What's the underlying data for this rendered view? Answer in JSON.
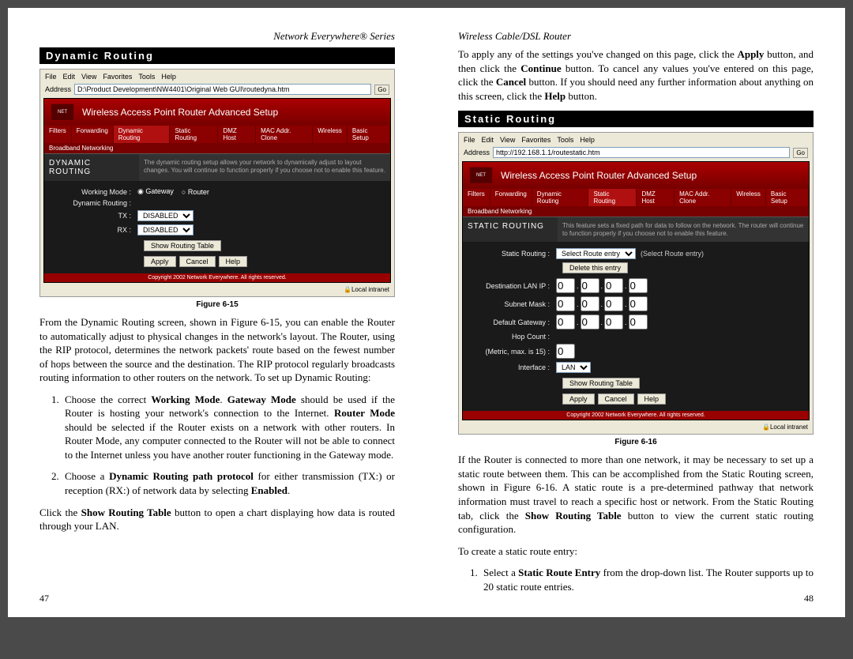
{
  "left": {
    "header": "Network Everywhere® Series",
    "section": "Dynamic Routing",
    "fig": {
      "menu": [
        "File",
        "Edit",
        "View",
        "Favorites",
        "Tools",
        "Help"
      ],
      "addr_label": "Address",
      "addr_value": "D:\\Product Development\\NW4401\\Original Web GUI\\routedyna.htm",
      "go": "Go",
      "router_title": "Wireless Access Point Router Advanced Setup",
      "tabs": [
        "Filters",
        "Forwarding",
        "Dynamic Routing",
        "Static Routing",
        "DMZ Host",
        "MAC Addr. Clone",
        "Wireless"
      ],
      "tab_right": "Basic Setup",
      "band": "Broadband Networking",
      "panel_name": "DYNAMIC ROUTING",
      "panel_desc": "The dynamic routing setup allows your network to dynamically adjust to layout changes. You will continue to function properly if you choose not to enable this feature.",
      "rows": {
        "mode_label": "Working Mode :",
        "mode_gateway": "Gateway",
        "mode_router": "Router",
        "dr_label": "Dynamic Routing :",
        "tx_label": "TX :",
        "rx_label": "RX :",
        "disabled": "DISABLED"
      },
      "btns": {
        "srt": "Show Routing Table",
        "apply": "Apply",
        "cancel": "Cancel",
        "help": "Help"
      },
      "copy": "Copyright 2002 Network Everywhere. All rights reserved.",
      "status": "Local intranet"
    },
    "caption": "Figure 6-15",
    "para1a": "From the Dynamic Routing screen, shown in Figure 6-15, you can enable the Router to automatically adjust to physical changes in the network's layout. The Router, using the RIP protocol, determines the network packets' route based on the fewest number of hops between the source and the destination. The RIP protocol regularly broadcasts routing information to other routers on the network. To set up Dynamic Routing:",
    "li1_pre": "Choose the correct ",
    "li1_b1": "Working Mode",
    "li1_mid1": ". ",
    "li1_b2": "Gateway Mode",
    "li1_mid2": " should be used if the Router is hosting your network's connection to the Internet. ",
    "li1_b3": "Router Mode",
    "li1_post": " should be selected if the Router exists on a network with other routers. In Router Mode, any computer connected to the Router will not be able to connect to the Internet unless you have another router functioning in the Gateway mode.",
    "li2_pre": "Choose a ",
    "li2_b1": "Dynamic Routing path protocol",
    "li2_mid": " for either transmission (TX:) or reception (RX:) of network data by selecting ",
    "li2_b2": "Enabled",
    "li2_post": ".",
    "para2a": "Click the ",
    "para2b": "Show Routing Table",
    "para2c": " button to open a chart displaying how data is routed through your LAN.",
    "pagenum": "47"
  },
  "right": {
    "header": "Wireless Cable/DSL Router",
    "intro_a": "To apply any of the settings you've changed on this page, click the ",
    "intro_b1": "Apply",
    "intro_c": " button, and then click the ",
    "intro_b2": "Continue",
    "intro_d": " button.  To cancel any values you've entered on this page, click the ",
    "intro_b3": "Cancel",
    "intro_e": " button. If you should need any further information about anything on this screen, click the ",
    "intro_b4": "Help",
    "intro_f": " button.",
    "section": "Static Routing",
    "fig": {
      "menu": [
        "File",
        "Edit",
        "View",
        "Favorites",
        "Tools",
        "Help"
      ],
      "addr_label": "Address",
      "addr_value": "http://192.168.1.1/routestatic.htm",
      "go": "Go",
      "router_title": "Wireless Access Point Router Advanced Setup",
      "tabs": [
        "Filters",
        "Forwarding",
        "Dynamic Routing",
        "Static Routing",
        "DMZ Host",
        "MAC Addr. Clone",
        "Wireless"
      ],
      "tab_right": "Basic Setup",
      "band": "Broadband Networking",
      "panel_name": "STATIC ROUTING",
      "panel_desc": "This feature sets a fixed path for data to follow on the network. The router will continue to function properly if you choose not to enable this feature.",
      "rows": {
        "sr_label": "Static Routing :",
        "sr_opt": "Select Route entry",
        "sr_hint": "(Select Route entry)",
        "del": "Delete this entry",
        "dlan": "Destination LAN IP :",
        "mask": "Subnet Mask :",
        "gw": "Default Gateway :",
        "hop": "Hop Count :",
        "hop_hint": "(Metric, max. is 15) :",
        "ifc": "Interface :",
        "lan": "LAN",
        "zero": "0"
      },
      "btns": {
        "srt": "Show Routing Table",
        "apply": "Apply",
        "cancel": "Cancel",
        "help": "Help"
      },
      "copy": "Copyright 2002 Network Everywhere. All rights reserved.",
      "status": "Local intranet"
    },
    "caption": "Figure 6-16",
    "para1a": "If the Router is connected to more than one network, it may be necessary to set up a static route between them. This can be accomplished from the Static Routing screen, shown in Figure 6-16. A static route is a pre-determined pathway that network information must travel to reach a specific host or network. From the Static Routing tab, click the ",
    "para1b": "Show Routing Table",
    "para1c": " button to view the current static routing configuration.",
    "para2": "To create a static route entry:",
    "li1_pre": "Select a ",
    "li1_b": "Static Route Entry",
    "li1_post": " from the drop-down list. The Router supports up to 20 static route entries.",
    "pagenum": "48"
  }
}
